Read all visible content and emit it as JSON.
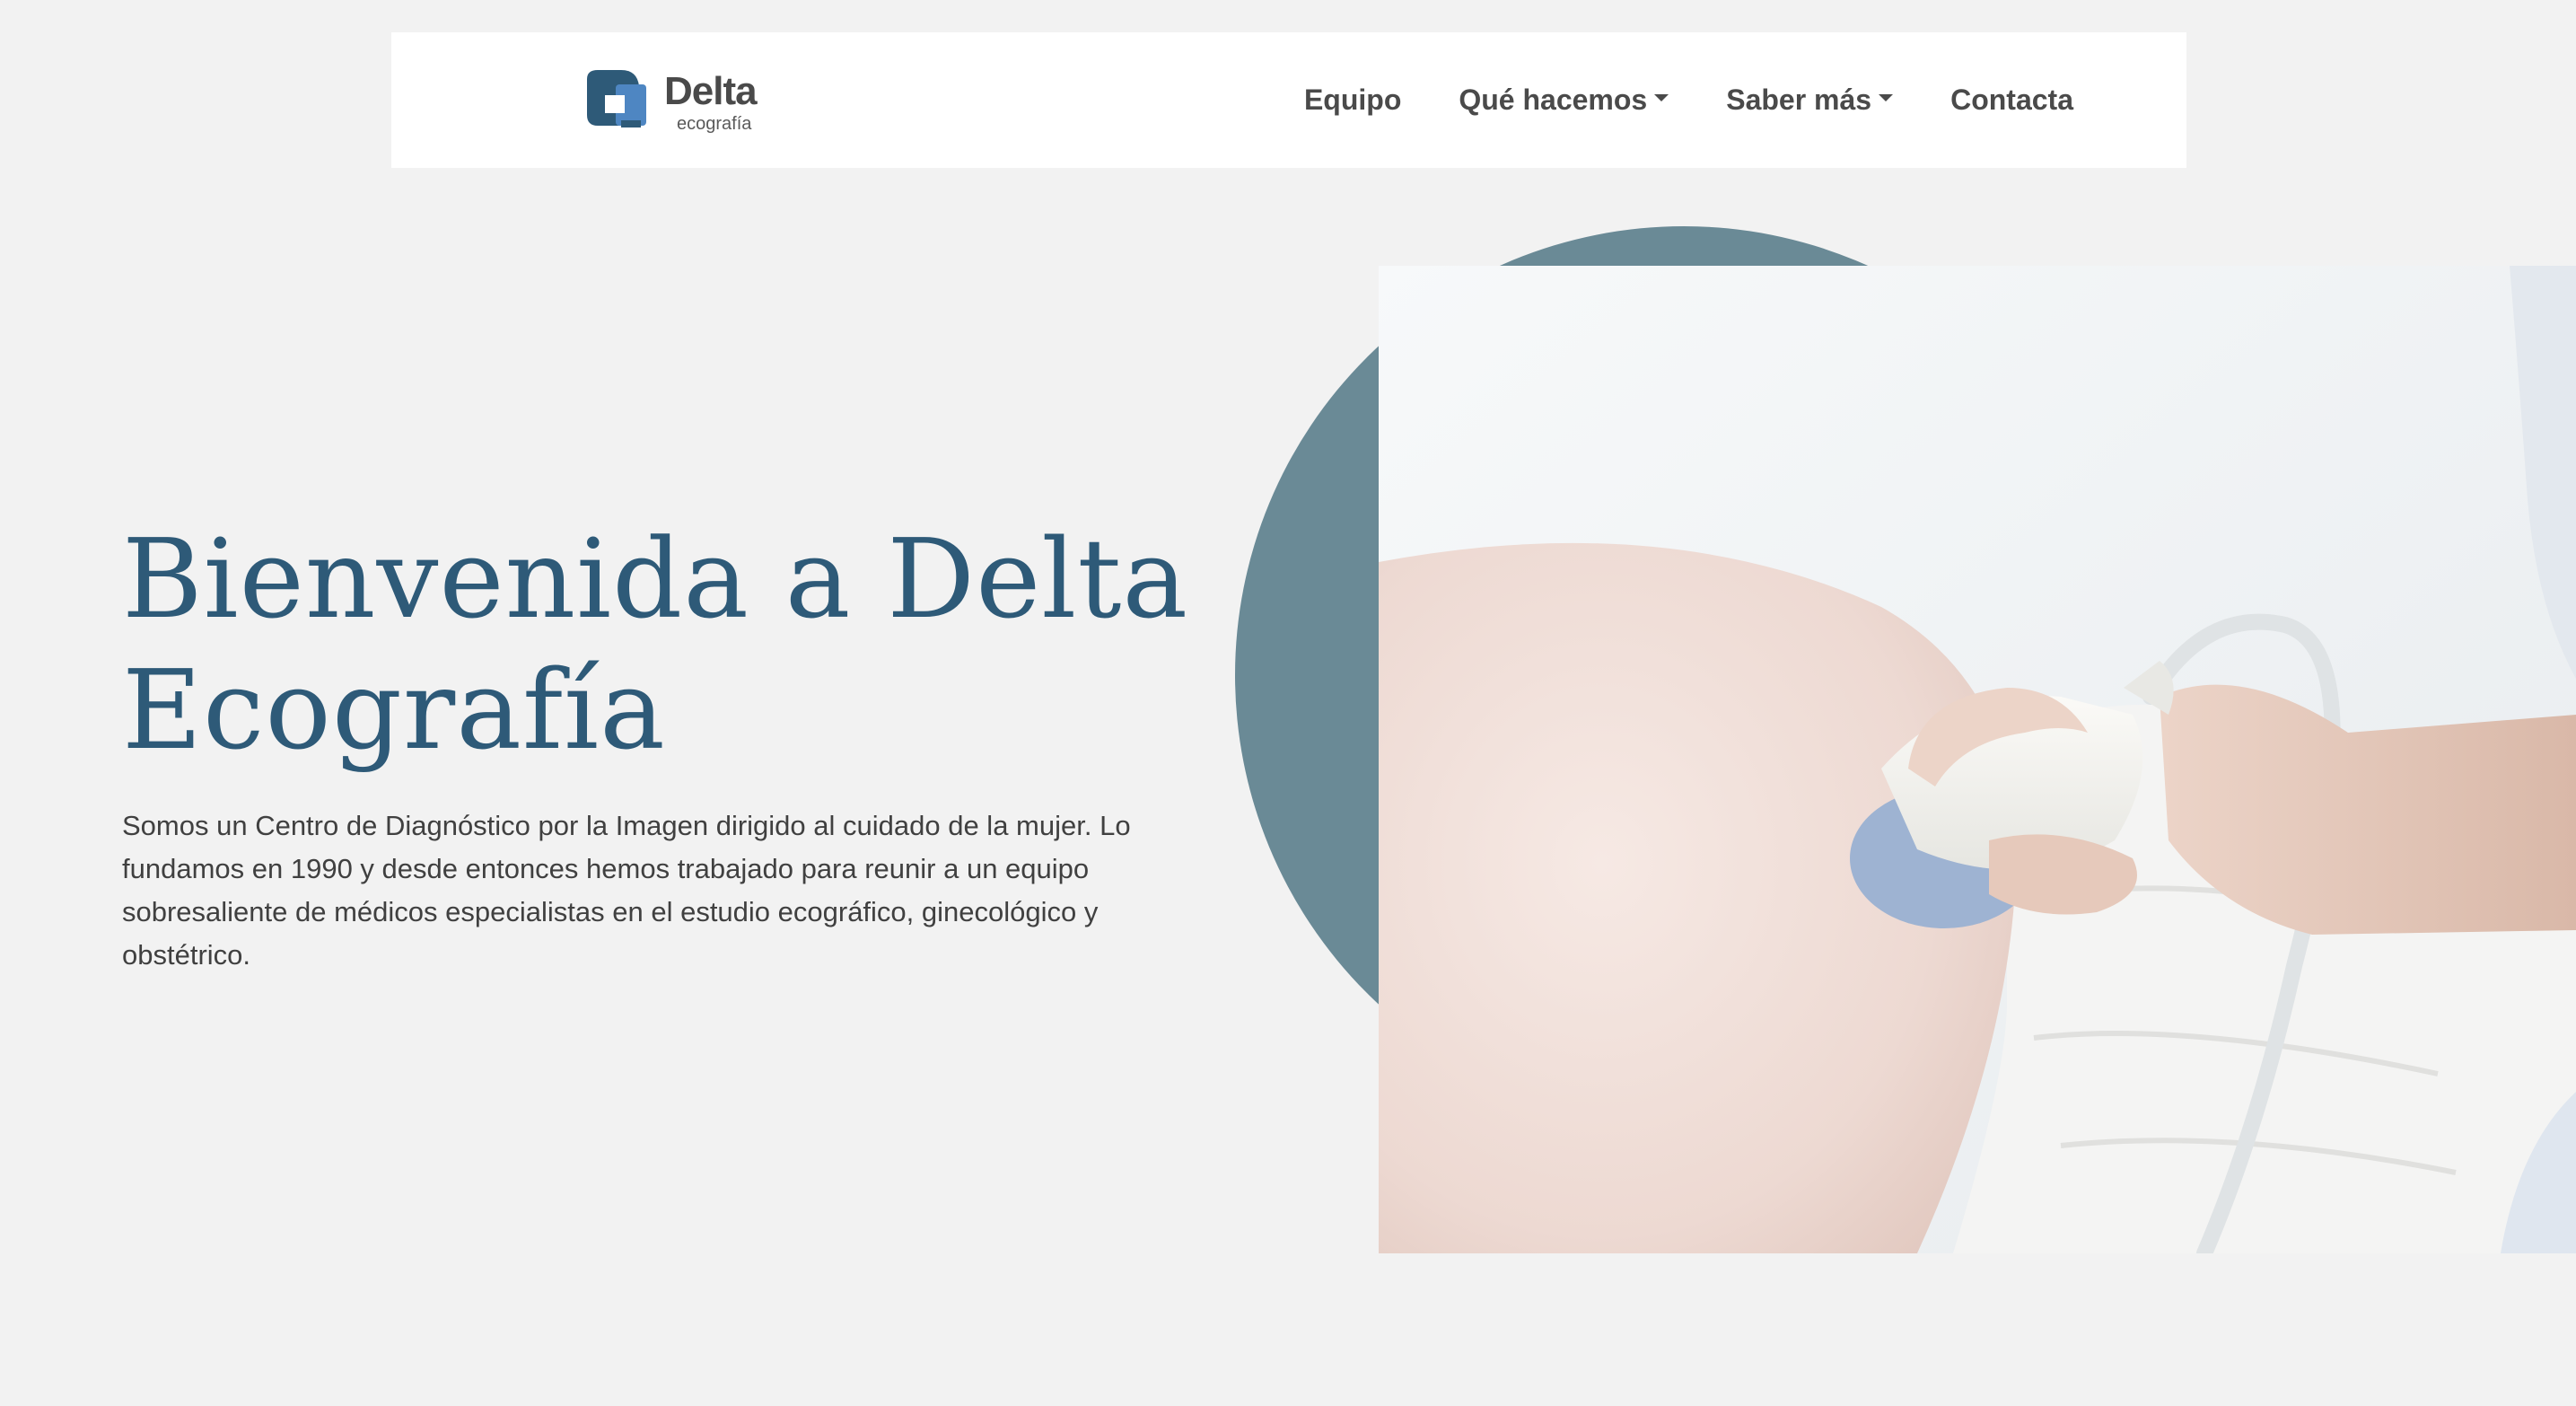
{
  "brand": {
    "name": "Delta",
    "tagline": "ecografía",
    "colors": {
      "primary": "#2e5a78",
      "logo_dark": "#2e5a78",
      "logo_light": "#4e86c2",
      "accent_circle": "#6a8a96",
      "background": "#f2f2f2"
    }
  },
  "nav": {
    "items": [
      {
        "label": "Equipo",
        "dropdown": false
      },
      {
        "label": "Qué hacemos",
        "dropdown": true
      },
      {
        "label": "Saber más",
        "dropdown": true
      },
      {
        "label": "Contacta",
        "dropdown": false
      }
    ]
  },
  "hero": {
    "title_line1": "Bienvenida a Delta",
    "title_line2": "Ecografía",
    "description": "Somos un Centro de Diagnóstico por la Imagen dirigido al cuidado de la mujer. Lo fundamos en 1990 y desde entonces hemos trabajado para reunir a un equipo sobresaliente de médicos especialistas en el estudio ecográfico, ginecológico y obstétrico.",
    "image": {
      "subject": "ultrasound-scan-on-pregnant-belly"
    }
  }
}
